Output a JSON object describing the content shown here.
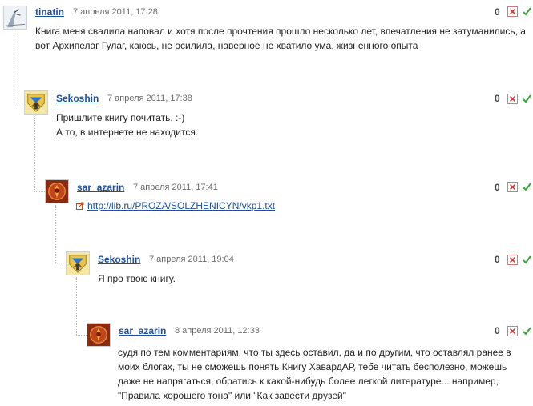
{
  "comments": [
    {
      "author": "tinatin",
      "date": "7 апреля 2011, 17:28",
      "rating": "0",
      "avatar_icon": "sketch-avatar-icon",
      "lines": [
        "Книга меня свалила наповал и хотя после прочтения прошло несколько лет, впечатления не затуманились, а",
        "вот Архипелаг Гулаг, каюсь, не осилила, наверное не хватило ума, жизненного опыта"
      ]
    },
    {
      "author": "Sekoshin",
      "date": "7 апреля 2011, 17:38",
      "rating": "0",
      "avatar_icon": "coat-of-arms-icon",
      "lines": [
        "Пришлите книгу почитать. :-)",
        "А то, в интернете не находится."
      ]
    },
    {
      "author": "sar_azarin",
      "date": "7 апреля 2011, 17:41",
      "rating": "0",
      "avatar_icon": "red-emblem-icon",
      "link": "http://lib.ru/PROZA/SOLZHENICYN/vkp1.txt"
    },
    {
      "author": "Sekoshin",
      "date": "7 апреля 2011, 19:04",
      "rating": "0",
      "avatar_icon": "coat-of-arms-icon",
      "lines": [
        "Я про твою книгу."
      ]
    },
    {
      "author": "sar_azarin",
      "date": "8 апреля 2011, 12:33",
      "rating": "0",
      "avatar_icon": "red-emblem-icon",
      "lines": [
        "судя по тем комментариям, что ты здесь оставил, да и по другим, что оставлял ранее в",
        "моих блогах, ты не сможешь понять Книгу ХавардАР, тебе читать бесполезно, можешь",
        "даже не напрягаться, обратись к какой-нибудь более легкой литературе... например,",
        "\"Правила хорошего тона\" или \"Как завести друзей\""
      ]
    }
  ],
  "colors": {
    "author_link": "#1d4f9c",
    "date": "#6b6b6b",
    "delete_red": "#cc3333",
    "approve_green": "#3aa63a"
  }
}
